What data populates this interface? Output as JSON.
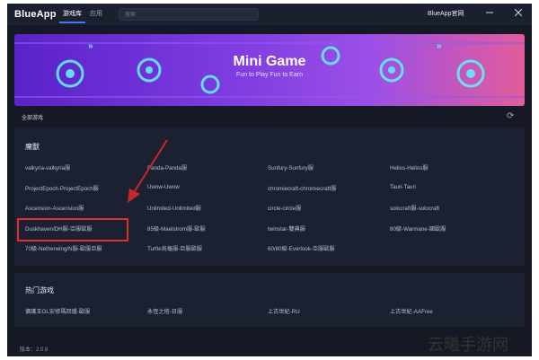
{
  "titlebar": {
    "logo": "BlueApp",
    "tabs": [
      {
        "label": "游戏库",
        "active": true
      },
      {
        "label": "应用",
        "active": false
      }
    ],
    "search_placeholder": "搜索",
    "site_link": "BlueApp官网",
    "window_buttons": [
      "minimize-icon",
      "close-icon"
    ]
  },
  "banner": {
    "title": "Mini Game",
    "subtitle": "Fun to Play Fun to Earn"
  },
  "section": {
    "title": "全部游戏",
    "refresh_icon": "refresh-icon"
  },
  "categories": [
    {
      "title": "魔獸",
      "items": [
        "valkyria-valkyria服",
        "Panda-Panda服",
        "Sunfury-Sunfury服",
        "Helios-Helios服",
        "ProjectEpoch-ProjectEpoch服",
        "Uwow-Uwow",
        "chromiecraft-chromiecraft服",
        "Tauri-Tauri",
        "Ascension-Ascension服",
        "Unlimited-Unlimited服",
        "circle-circle服",
        "solocraft服-solocraft",
        "Duskhaven/DH服-亞服歐服",
        "85級-Maelstrom服-歐服",
        "twinstar-雙典服",
        "80級-Warmane-國歐服",
        "70級-Netherwing/N服-歐服亞服",
        "Turtle烏龜服-亞服歐服",
        "60/80級-Everlook-亞服歐服"
      ]
    },
    {
      "title": "热门游戏",
      "items": [
        "傭護王OL安修瑪回爐-歐服",
        "永恆之塔-日服",
        "上古世紀-RU",
        "上古世紀-AAFree"
      ]
    }
  ],
  "highlighted_item": "Duskhaven/DH服-亞服歐服",
  "footer": {
    "version": "版本：2.0.8"
  },
  "watermark": "云曦手游网",
  "colors": {
    "background": "#141924",
    "panel": "#1b2131",
    "accent": "#3d7cff",
    "highlight_box": "#e0302e",
    "arrow": "#c8282a"
  }
}
